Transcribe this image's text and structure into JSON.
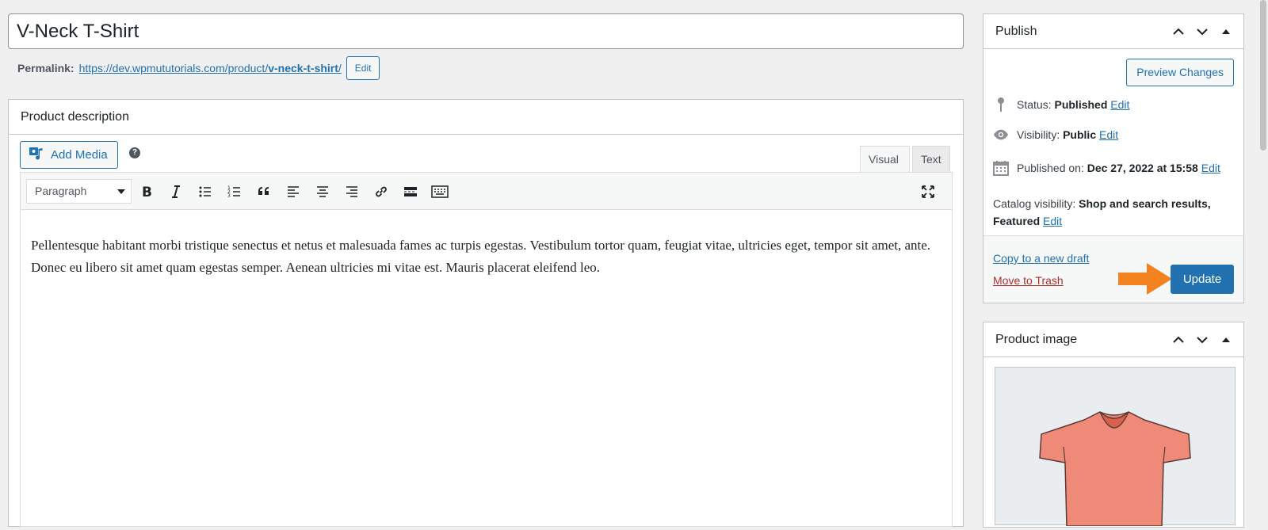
{
  "post": {
    "title": "V-Neck T-Shirt",
    "permalink_label": "Permalink:",
    "permalink_base": "https://dev.wpmututorials.com/product/",
    "permalink_slug": "v-neck-t-shirt",
    "permalink_trail": "/",
    "edit_label": "Edit"
  },
  "editor": {
    "box_title": "Product description",
    "add_media_label": "Add Media",
    "help_glyph": "?",
    "tabs": {
      "visual": "Visual",
      "text": "Text"
    },
    "format": "Paragraph",
    "content": "Pellentesque habitant morbi tristique senectus et netus et malesuada fames ac turpis egestas. Vestibulum tortor quam, feugiat vitae, ultricies eget, tempor sit amet, ante. Donec eu libero sit amet quam egestas semper. Aenean ultricies mi vitae est. Mauris placerat eleifend leo."
  },
  "publish": {
    "title": "Publish",
    "preview_label": "Preview Changes",
    "status_label": "Status:",
    "status_value": "Published",
    "visibility_label": "Visibility:",
    "visibility_value": "Public",
    "published_label": "Published on:",
    "published_value": "Dec 27, 2022 at 15:58",
    "catalog_label": "Catalog visibility:",
    "catalog_value": "Shop and search results, Featured",
    "edit_label": "Edit",
    "copy_label": "Copy to a new draft",
    "trash_label": "Move to Trash",
    "update_label": "Update"
  },
  "product_image": {
    "title": "Product image"
  },
  "colors": {
    "primary": "#2271b1",
    "danger": "#b32d2e",
    "arrow": "#f58220",
    "shirt": "#f08a78"
  }
}
